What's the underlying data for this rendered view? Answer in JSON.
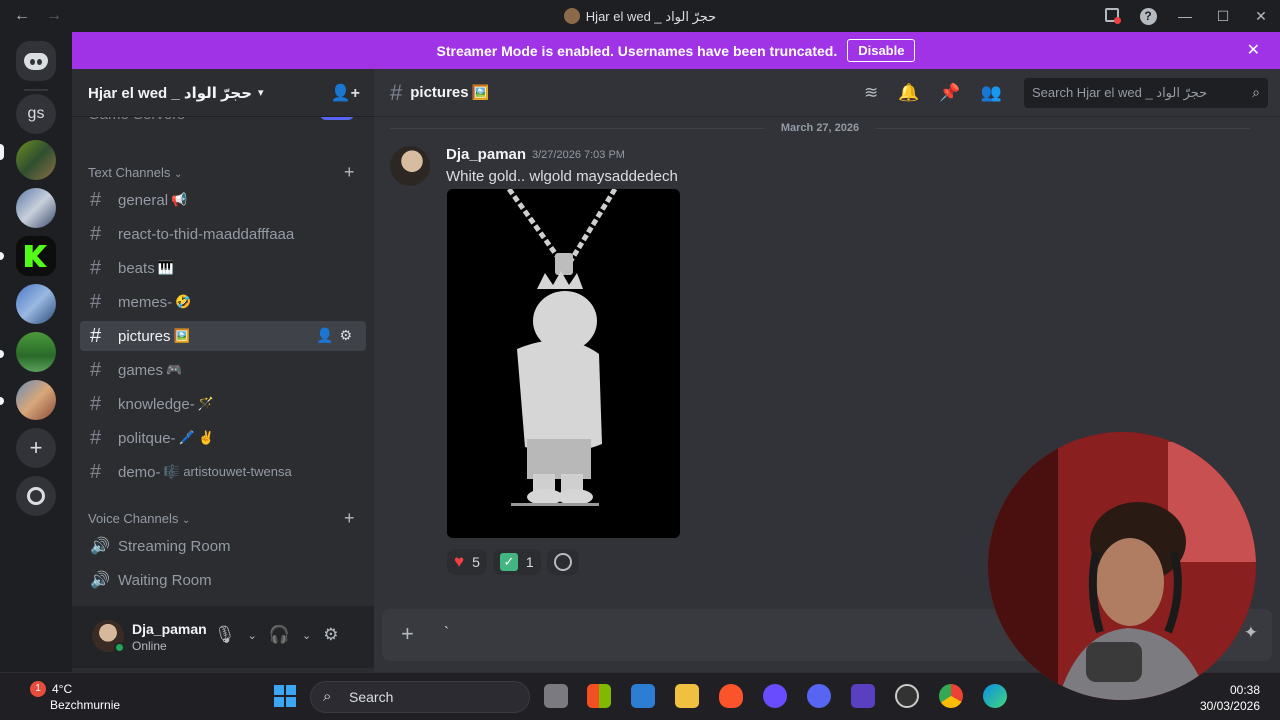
{
  "window": {
    "title": "Hjar el wed _ حجرّ الواد",
    "back_icon": "←",
    "forward_icon": "→"
  },
  "banner": {
    "text": "Streamer Mode is enabled. Usernames have been truncated.",
    "disable_label": "Disable"
  },
  "rail": {
    "gs_label": "gs"
  },
  "server": {
    "name": "Hjar el wed _ حجرّ الواد",
    "cut_item": "Game Servers",
    "text_category": "Text Channels",
    "voice_category": "Voice Channels",
    "text_channels": [
      {
        "name": "general",
        "emoji": "📢"
      },
      {
        "name": "react-to-thid-maaddafffaaa",
        "emoji": ""
      },
      {
        "name": "beats",
        "emoji": "🎹"
      },
      {
        "name": "memes-",
        "emoji": "🤣"
      },
      {
        "name": "pictures",
        "emoji": "🖼️"
      },
      {
        "name": "games",
        "emoji": "🎮"
      },
      {
        "name": "knowledge-",
        "emoji": "🪄"
      },
      {
        "name": "politque-",
        "emoji": "🖊️ ✌️"
      },
      {
        "name": "demo-",
        "emoji": "🎼 artistouwet-twensa"
      }
    ],
    "voice_channels": [
      {
        "name": "Streaming Room"
      },
      {
        "name": "Waiting Room"
      }
    ]
  },
  "user": {
    "name": "Dja_paman",
    "status": "Online"
  },
  "channel": {
    "name": "pictures",
    "emoji": "🖼️",
    "search_placeholder": "Search Hjar el wed _ حجرّ الواد"
  },
  "messages": {
    "date_divider": "March 27, 2026",
    "author": "Dja_paman",
    "timestamp": "3/27/2026 7:03 PM",
    "text": "White gold.. wlgold maysaddedech",
    "reactions": [
      {
        "emoji": "heart",
        "count": "5"
      },
      {
        "emoji": "check",
        "count": "1"
      }
    ]
  },
  "composer": {
    "value": "`"
  },
  "taskbar": {
    "weather_badge": "1",
    "temperature": "4°C",
    "location": "Bezchmurnie",
    "search_label": "Search",
    "time": "00:38",
    "date": "30/03/2026"
  },
  "colors": {
    "banner": "#a033e5",
    "accent": "#5865f2",
    "online": "#23a55a"
  }
}
